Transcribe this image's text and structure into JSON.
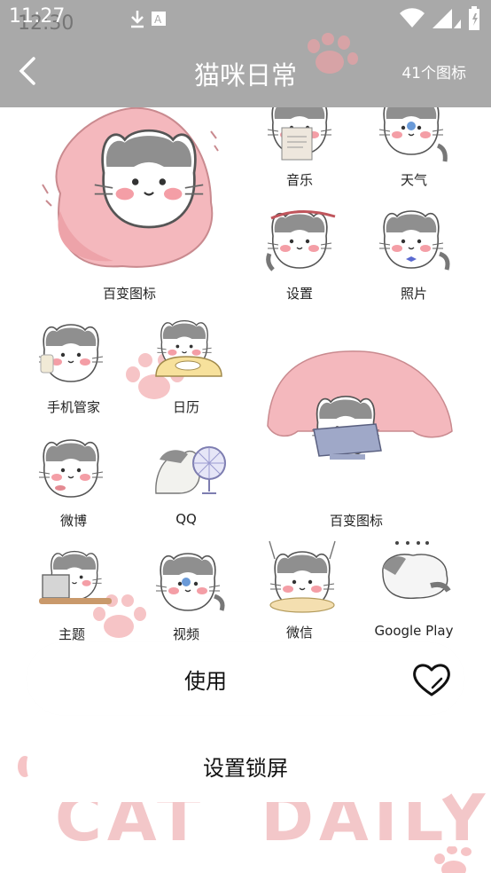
{
  "status_bar": {
    "time": "11:27",
    "time_ghost": "12:30",
    "icons": [
      "download-icon",
      "a-icon",
      "wifi-icon",
      "signal-icon",
      "battery-icon"
    ]
  },
  "header": {
    "title": "猫咪日常",
    "count": "41个图标",
    "background": "#a9a9a9"
  },
  "icons": [
    {
      "label": "百变图标"
    },
    {
      "label": "音乐"
    },
    {
      "label": "天气"
    },
    {
      "label": "设置"
    },
    {
      "label": "照片"
    },
    {
      "label": "手机管家"
    },
    {
      "label": "日历"
    },
    {
      "label": "百变图标"
    },
    {
      "label": "微博"
    },
    {
      "label": "QQ"
    },
    {
      "label": "主题"
    },
    {
      "label": "视频"
    },
    {
      "label": "微信"
    },
    {
      "label": "Google Play"
    }
  ],
  "actions": {
    "use_label": "使用",
    "lock_label": "设置锁屏"
  },
  "banner": "CAT  DAILY",
  "colors": {
    "pink": "#f3b9bc",
    "gray": "#8a8a8a",
    "paw": "#f6c4c6"
  }
}
